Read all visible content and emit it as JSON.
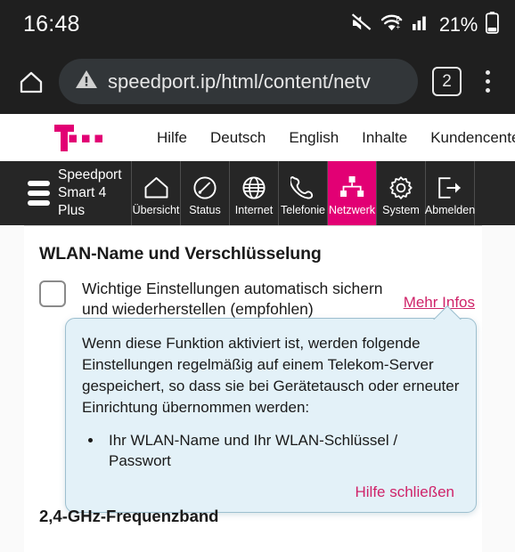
{
  "statusbar": {
    "time": "16:48",
    "battery_percent": "21%",
    "icons": [
      "mute-icon",
      "wifi-icon",
      "signal-icon",
      "battery-icon"
    ]
  },
  "browser": {
    "home_icon": "home-icon",
    "security_icon": "warning-triangle-icon",
    "url": "speedport.ip/html/content/netv",
    "tab_count": "2",
    "menu_icon": "kebab-menu-icon"
  },
  "site_header": {
    "logo": "telekom-logo",
    "links": [
      "Hilfe",
      "Deutsch",
      "English",
      "Inhalte",
      "Kundencenter"
    ]
  },
  "product_nav": {
    "brand_line1": "Speedport",
    "brand_line2": "Smart 4 Plus",
    "menu_icon": "hamburger-icon",
    "active_color": "#e20074",
    "items": [
      {
        "label": "Übersicht",
        "icon": "house-icon",
        "active": false
      },
      {
        "label": "Status",
        "icon": "speedometer-icon",
        "active": false
      },
      {
        "label": "Internet",
        "icon": "globe-icon",
        "active": false
      },
      {
        "label": "Telefonie",
        "icon": "phone-icon",
        "active": false
      },
      {
        "label": "Netzwerk",
        "icon": "network-icon",
        "active": true
      },
      {
        "label": "System",
        "icon": "gear-icon",
        "active": false
      },
      {
        "label": "Abmelden",
        "icon": "logout-icon",
        "active": false
      }
    ]
  },
  "main": {
    "card_title": "WLAN-Name und Verschlüsselung",
    "option": {
      "checked": false,
      "label_line1": "Wichtige Einstellungen automatisch sichern",
      "label_line2": "und wiederherstellen (empfohlen)",
      "more_info_label": "Mehr Infos",
      "link_color": "#cf2369"
    },
    "tooltip": {
      "body": "Wenn diese Funktion aktiviert ist, werden folgende Einstellungen regelmäßig auf einem Telekom-Server gespeichert, so dass sie bei Gerätetausch oder erneuter Einrichtung übernommen werden:",
      "bullets": [
        "Ihr WLAN-Name und Ihr WLAN-Schlüssel / Passwort"
      ],
      "close_label": "Hilfe schließen",
      "background": "#e3f1f8",
      "border": "#9dbfcf"
    },
    "band_title": "2,4-GHz-Frequenzband"
  }
}
